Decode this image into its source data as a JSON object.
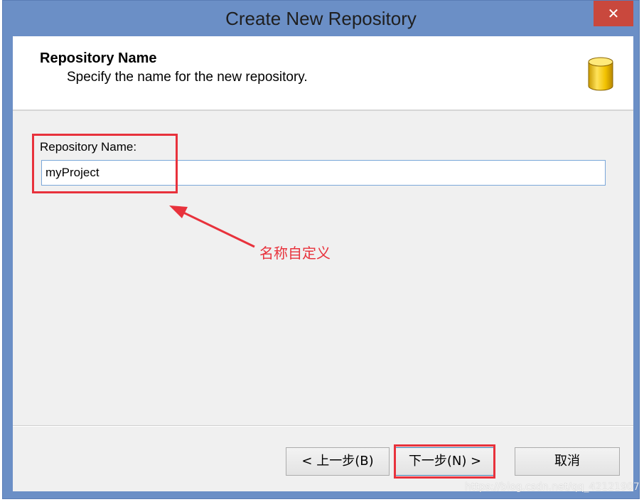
{
  "window": {
    "title": "Create New Repository",
    "close_glyph": "✕",
    "accent_color": "#6b8fc6",
    "close_color": "#c9483d"
  },
  "header": {
    "title": "Repository Name",
    "subtitle": "Specify the name for the new repository.",
    "icon": "database-icon"
  },
  "form": {
    "label": "Repository Name:",
    "value": "myProject"
  },
  "annotation": {
    "text": "名称自定义",
    "color": "#e8323c"
  },
  "buttons": {
    "back": "< 上一步(B)",
    "next": "下一步(N) >",
    "cancel": "取消"
  },
  "watermark": "https://blog.csdn.net/qq_42121907"
}
